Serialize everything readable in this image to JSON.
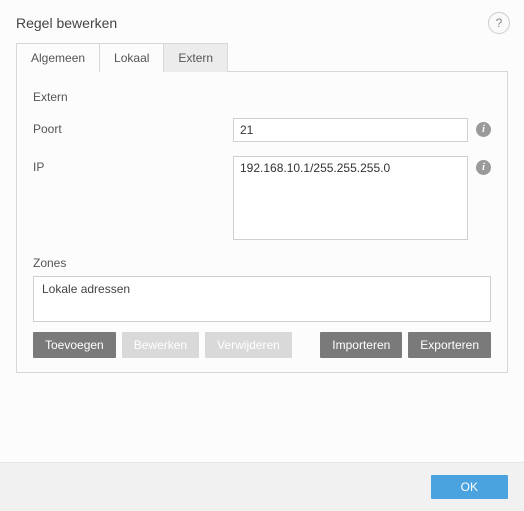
{
  "title": "Regel bewerken",
  "tabs": {
    "general": "Algemeen",
    "local": "Lokaal",
    "extern": "Extern"
  },
  "panel": {
    "heading": "Extern",
    "port_label": "Poort",
    "port_value": "21",
    "ip_label": "IP",
    "ip_value": "192.168.10.1/255.255.255.0",
    "zones_label": "Zones",
    "zones_items": [
      "Lokale adressen"
    ]
  },
  "buttons": {
    "add": "Toevoegen",
    "edit": "Bewerken",
    "delete": "Verwijderen",
    "import": "Importeren",
    "export": "Exporteren",
    "ok": "OK"
  }
}
